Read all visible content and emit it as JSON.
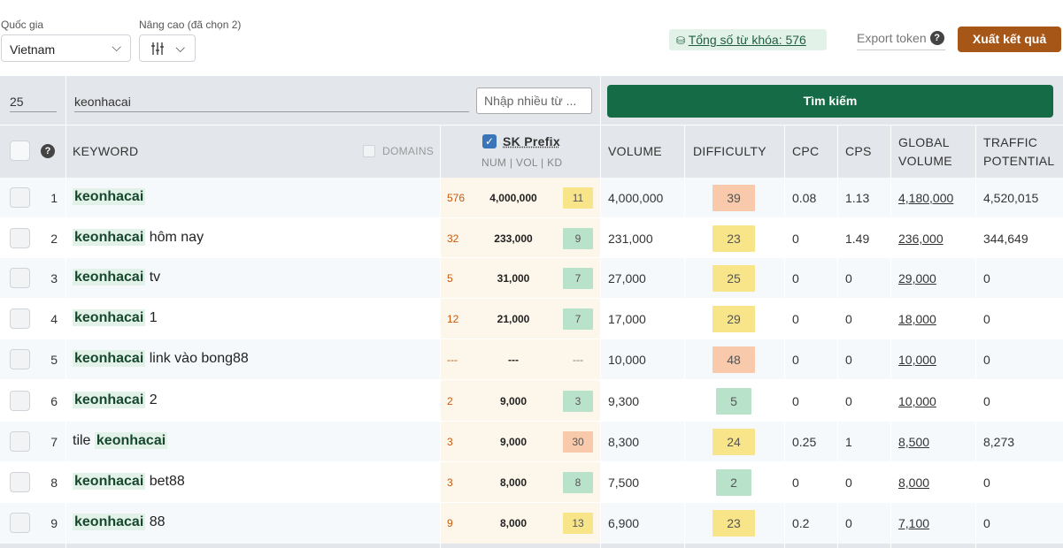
{
  "filters": {
    "country_label": "Quốc gia",
    "country_value": "Vietnam",
    "advanced_label": "Nâng cao (đã chọn 2)"
  },
  "summary": {
    "total_label": "Tổng số từ khóa: 576",
    "export_token": "Export token",
    "export_results": "Xuất kết quả"
  },
  "search": {
    "limit": "25",
    "keyword": "keonhacai",
    "multi_placeholder": "Nhập nhiều từ ...",
    "button": "Tìm kiếm"
  },
  "columns": {
    "keyword": "KEYWORD",
    "domains": "DOMAINS",
    "sk_prefix": "SK Prefix",
    "sk_sub": "NUM | VOL | KD",
    "volume": "VOLUME",
    "difficulty": "DIFFICULTY",
    "cpc": "CPC",
    "cps": "CPS",
    "global_volume": "GLOBAL VOLUME",
    "traffic_potential": "TRAFFIC POTENTIAL"
  },
  "rows": [
    {
      "n": "1",
      "pre": "",
      "hl": "keonhacai",
      "post": "",
      "num": "576",
      "vol": "4,000,000",
      "kd": "11",
      "volume": "4,000,000",
      "difficulty": "39",
      "cpc": "0.08",
      "cps": "1.13",
      "gvol": "4,180,000",
      "tp": "4,520,015"
    },
    {
      "n": "2",
      "pre": "",
      "hl": "keonhacai",
      "post": " hôm nay",
      "num": "32",
      "vol": "233,000",
      "kd": "9",
      "volume": "231,000",
      "difficulty": "23",
      "cpc": "0",
      "cps": "1.49",
      "gvol": "236,000",
      "tp": "344,649"
    },
    {
      "n": "3",
      "pre": "",
      "hl": "keonhacai",
      "post": " tv",
      "num": "5",
      "vol": "31,000",
      "kd": "7",
      "volume": "27,000",
      "difficulty": "25",
      "cpc": "0",
      "cps": "0",
      "gvol": "29,000",
      "tp": "0"
    },
    {
      "n": "4",
      "pre": "",
      "hl": "keonhacai",
      "post": " 1",
      "num": "12",
      "vol": "21,000",
      "kd": "7",
      "volume": "17,000",
      "difficulty": "29",
      "cpc": "0",
      "cps": "0",
      "gvol": "18,000",
      "tp": "0"
    },
    {
      "n": "5",
      "pre": "",
      "hl": "keonhacai",
      "post": " link vào bong88",
      "num": "---",
      "vol": "---",
      "kd": "---",
      "volume": "10,000",
      "difficulty": "48",
      "cpc": "0",
      "cps": "0",
      "gvol": "10,000",
      "tp": "0"
    },
    {
      "n": "6",
      "pre": "",
      "hl": "keonhacai",
      "post": " 2",
      "num": "2",
      "vol": "9,000",
      "kd": "3",
      "volume": "9,300",
      "difficulty": "5",
      "cpc": "0",
      "cps": "0",
      "gvol": "10,000",
      "tp": "0"
    },
    {
      "n": "7",
      "pre": "tile ",
      "hl": "keonhacai",
      "post": "",
      "num": "3",
      "vol": "9,000",
      "kd": "30",
      "volume": "8,300",
      "difficulty": "24",
      "cpc": "0.25",
      "cps": "1",
      "gvol": "8,500",
      "tp": "8,273"
    },
    {
      "n": "8",
      "pre": "",
      "hl": "keonhacai",
      "post": " bet88",
      "num": "3",
      "vol": "8,000",
      "kd": "8",
      "volume": "7,500",
      "difficulty": "2",
      "cpc": "0",
      "cps": "0",
      "gvol": "8,000",
      "tp": "0"
    },
    {
      "n": "9",
      "pre": "",
      "hl": "keonhacai",
      "post": " 88",
      "num": "9",
      "vol": "8,000",
      "kd": "13",
      "volume": "6,900",
      "difficulty": "23",
      "cpc": "0.2",
      "cps": "0",
      "gvol": "7,100",
      "tp": "0"
    }
  ],
  "colors": {
    "primary_green": "#156b45",
    "export_brown": "#a65617",
    "kd_easy": "#b9e2ca",
    "kd_medium": "#f8e58a",
    "kd_hard": "#f8c9ab"
  }
}
